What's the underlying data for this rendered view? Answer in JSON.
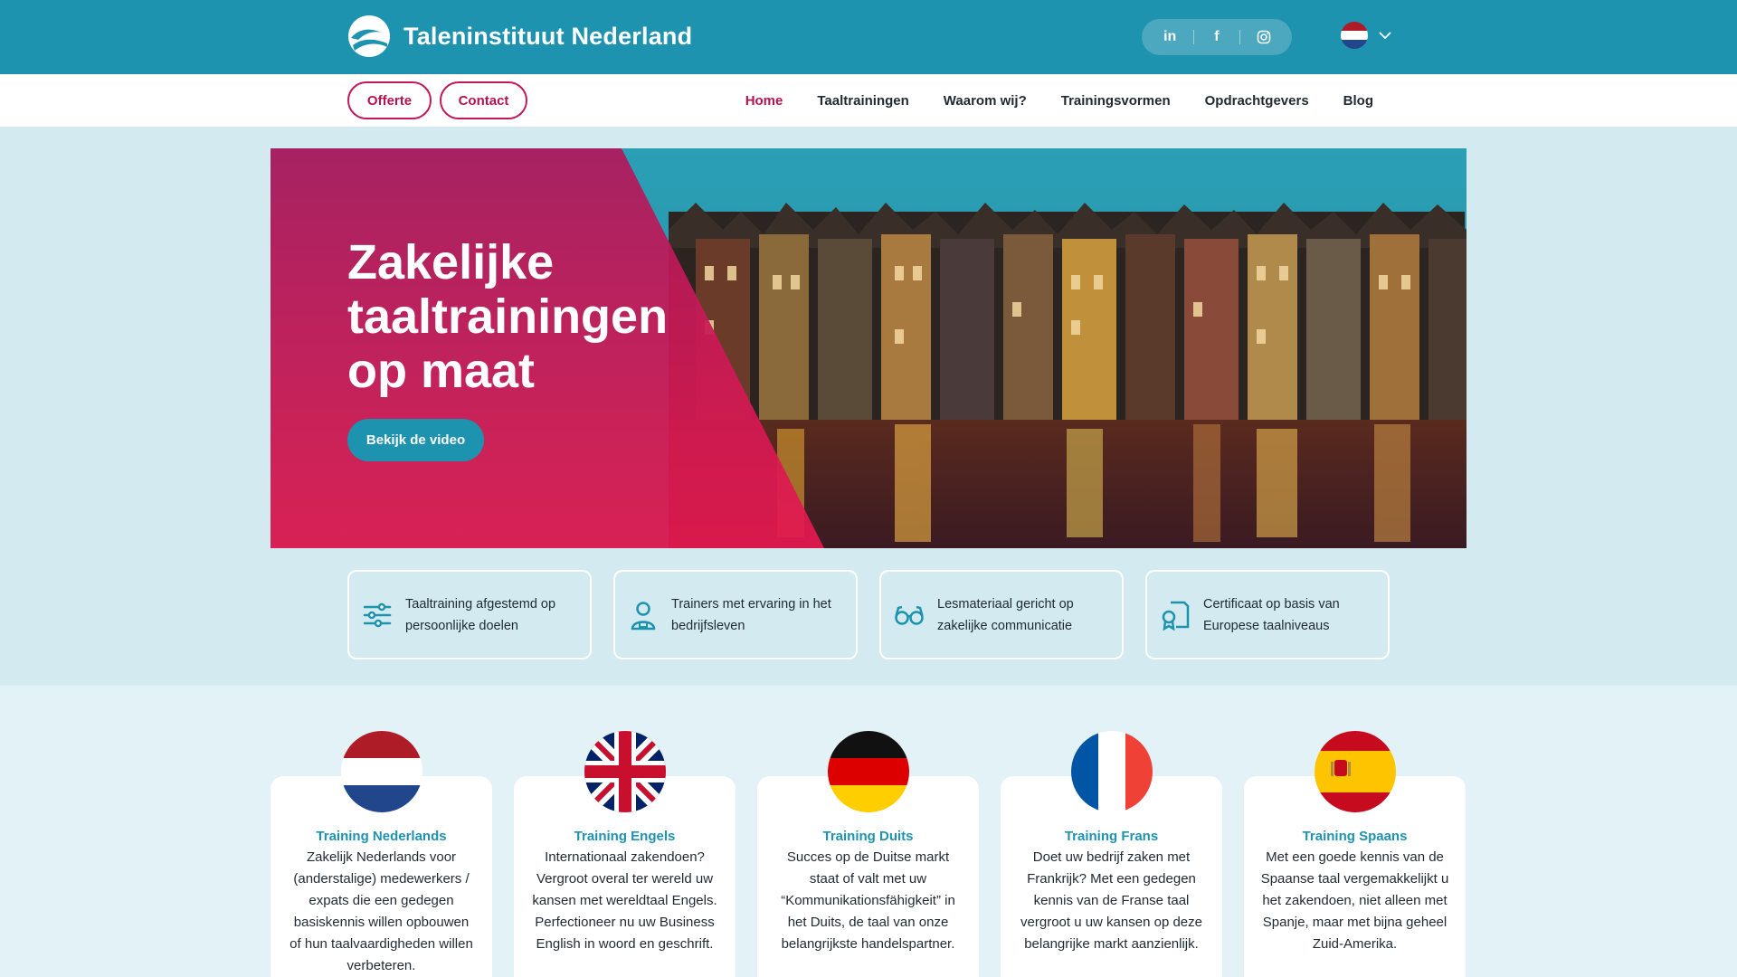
{
  "header": {
    "brand": "Taleninstituut Nederland",
    "social": [
      {
        "icon": "linkedin-icon",
        "label": "in"
      },
      {
        "icon": "facebook-icon",
        "label": "f"
      },
      {
        "icon": "instagram-icon",
        "label": ""
      }
    ],
    "language_icon": "dutch-flag-icon"
  },
  "nav": {
    "offerte": "Offerte",
    "contact": "Contact",
    "items": [
      "Home",
      "Taaltrainingen",
      "Waarom wij?",
      "Trainingsvormen",
      "Opdrachtgevers",
      "Blog"
    ],
    "active": "Home"
  },
  "hero": {
    "title": "Zakelijke taaltrainingen op maat",
    "button": "Bekijk de video"
  },
  "features": [
    {
      "icon": "sliders-icon",
      "text": "Taaltraining afgestemd op persoonlijke doelen"
    },
    {
      "icon": "trainer-icon",
      "text": "Trainers met ervaring in het bedrijfsleven"
    },
    {
      "icon": "glasses-icon",
      "text": "Lesmateriaal gericht op zakelijke communicatie"
    },
    {
      "icon": "certificate-icon",
      "text": "Certificaat op basis van Europese taalniveaus"
    }
  ],
  "trainings": [
    {
      "flag": "dutch-flag-icon",
      "title": "Training Nederlands",
      "desc": "Zakelijk Nederlands voor (anderstalige) medewerkers / expats die een gedegen basiskennis willen opbouwen of hun taalvaardigheden willen verbeteren."
    },
    {
      "flag": "uk-flag-icon",
      "title": "Training Engels",
      "desc": "Internationaal zakendoen? Vergroot overal ter wereld uw kansen met wereldtaal Engels. Perfectioneer nu uw Business English in woord en geschrift."
    },
    {
      "flag": "german-flag-icon",
      "title": "Training Duits",
      "desc": "Succes op de Duitse markt staat of valt met uw “Kommunikationsfähigkeit” in het Duits, de taal van onze belangrijkste handelspartner."
    },
    {
      "flag": "french-flag-icon",
      "title": "Training Frans",
      "desc": "Doet uw bedrijf zaken met Frankrijk? Met een gedegen kennis van de Franse taal vergroot u uw kansen op deze belangrijke markt aanzienlijk."
    },
    {
      "flag": "spanish-flag-icon",
      "title": "Training Spaans",
      "desc": "Met een goede kennis van de Spaanse taal vergemakkelijkt u het zakendoen, niet alleen met Spanje, maar met bijna geheel Zuid-Amerika."
    }
  ],
  "colors": {
    "primary": "#1e93b0",
    "accent": "#c2185b",
    "background": "#d3ebf0"
  }
}
